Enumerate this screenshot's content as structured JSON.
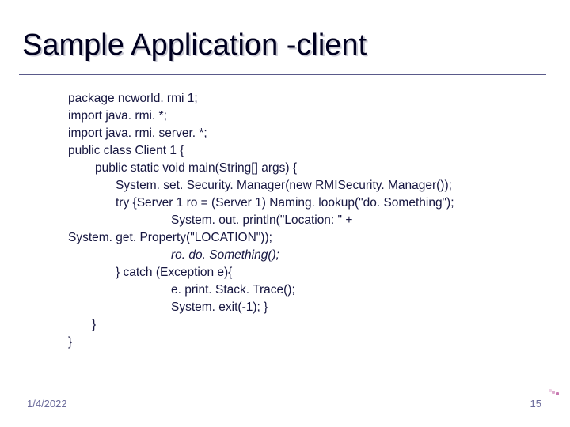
{
  "title": "Sample Application -client",
  "code": {
    "l1": "package ncworld. rmi 1;",
    "l2": "import java. rmi. *;",
    "l3": "import java. rmi. server. *;",
    "l4": "public class Client 1 {",
    "l5": "public static void main(String[] args) {",
    "l6": "System. set. Security. Manager(new RMISecurity. Manager());",
    "l7": "try {Server 1 ro = (Server 1) Naming. lookup(\"do. Something\");",
    "l8": "System. out. println(\"Location: \" +",
    "l9": "System. get. Property(\"LOCATION\"));",
    "l10": "ro. do. Something();",
    "l11": "} catch (Exception e){",
    "l12": "e. print. Stack. Trace();",
    "l13": "System. exit(-1); }",
    "l14": "}",
    "l15": "}"
  },
  "footer": {
    "date": "1/4/2022",
    "page": "15"
  }
}
